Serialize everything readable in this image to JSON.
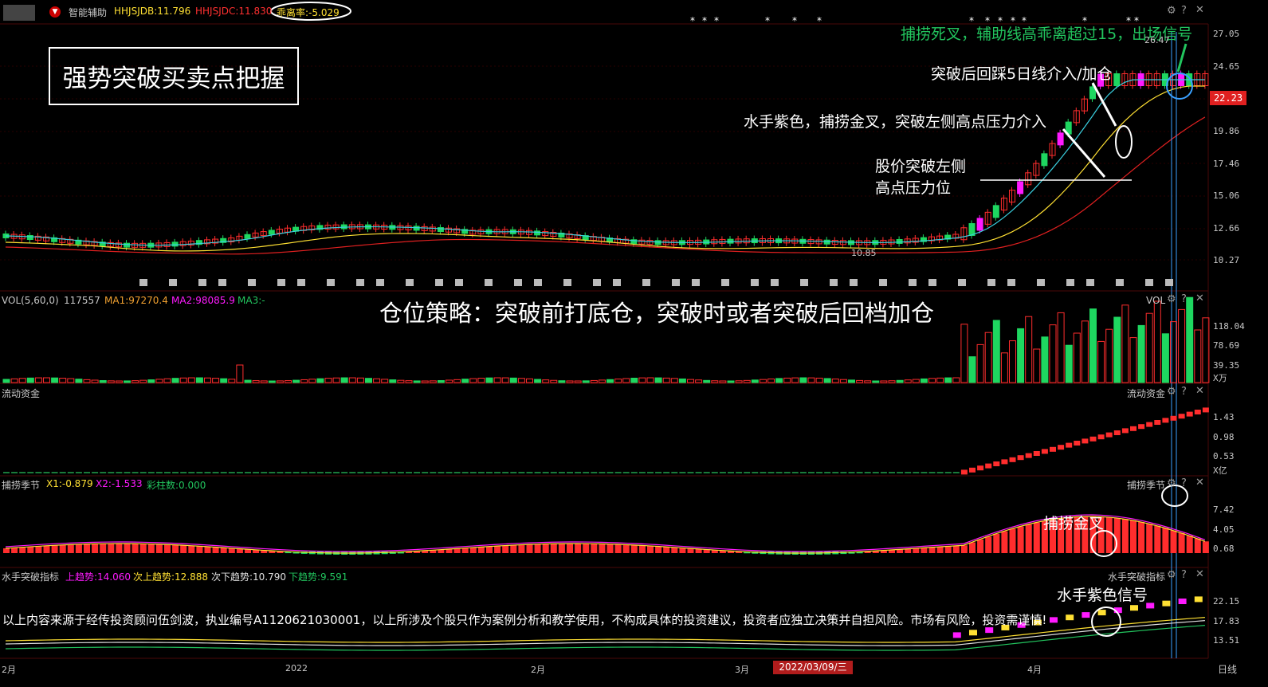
{
  "header": {
    "indicator_name": "智能辅助",
    "hhjsjdb": "HHJSJDB:11.796",
    "hhjsjdc": "HHJSJDC:11.830",
    "deviation": "乖离率:-5.029"
  },
  "title_box": "强势突破买卖点把握",
  "annotations": {
    "death_cross": "捕捞死叉，辅助线高乖离超过15，出场信号",
    "pullback": "突破后回踩5日线介入/加仓",
    "purple_cross": "水手紫色，捕捞金叉，突破左侧高点压力介入",
    "breakout_line1": "股价突破左侧",
    "breakout_line2": "高点压力位",
    "position_strategy": "仓位策略：突破前打底仓，突破时或者突破后回档加仓",
    "golden_cross": "捕捞金叉",
    "sailor_purple": "水手紫色信号",
    "disclaimer": "以上内容来源于经传投资顾问伍剑波，执业编号A1120621030001，以上所涉及个股只作为案例分析和教学使用，不构成具体的投资建议，投资者应独立决策并自担风险。市场有风险，投资需谨慎!"
  },
  "price_panel": {
    "y_ticks": [
      "27.05",
      "24.65",
      "22.23",
      "19.86",
      "17.46",
      "15.06",
      "12.66",
      "10.27"
    ],
    "current_price": "22.23",
    "high_label": "26.47",
    "low_label": "10.85"
  },
  "vol_panel": {
    "name": "VOL(5,60,0)",
    "value": "117557",
    "ma1": "MA1:97270.4",
    "ma2": "MA2:98085.9",
    "ma3": "MA3:-",
    "title_right": "VOL",
    "y_ticks": [
      "118.04",
      "78.69",
      "39.35"
    ],
    "unit": "X万"
  },
  "flow_panel": {
    "name": "流动资金",
    "title_right": "流动资金",
    "y_ticks": [
      "1.43",
      "0.98",
      "0.53"
    ],
    "unit": "X亿"
  },
  "catch_panel": {
    "name": "捕捞季节",
    "x1": "X1:-0.879",
    "x2": "X2:-1.533",
    "bars": "彩柱数:0.000",
    "title_right": "捕捞季节",
    "y_ticks": [
      "7.42",
      "4.05",
      "0.68"
    ]
  },
  "sailor_panel": {
    "name": "水手突破指标",
    "up": "上趋势:14.060",
    "up2": "次上趋势:12.888",
    "down2": "次下趋势:10.790",
    "down": "下趋势:9.591",
    "title_right": "水手突破指标",
    "y_ticks": [
      "22.15",
      "17.83",
      "13.51"
    ]
  },
  "x_axis": {
    "labels": [
      "2月",
      "2022",
      "2月",
      "3月",
      "4月"
    ],
    "cursor_date": "2022/03/09/三",
    "period": "日线"
  },
  "colors": {
    "up": "#ff2d2d",
    "down": "#1ed760",
    "purple": "#ff1aff",
    "ma5": "#3ad0e0",
    "ma10": "#ffe033",
    "ma20": "#e02020"
  }
}
